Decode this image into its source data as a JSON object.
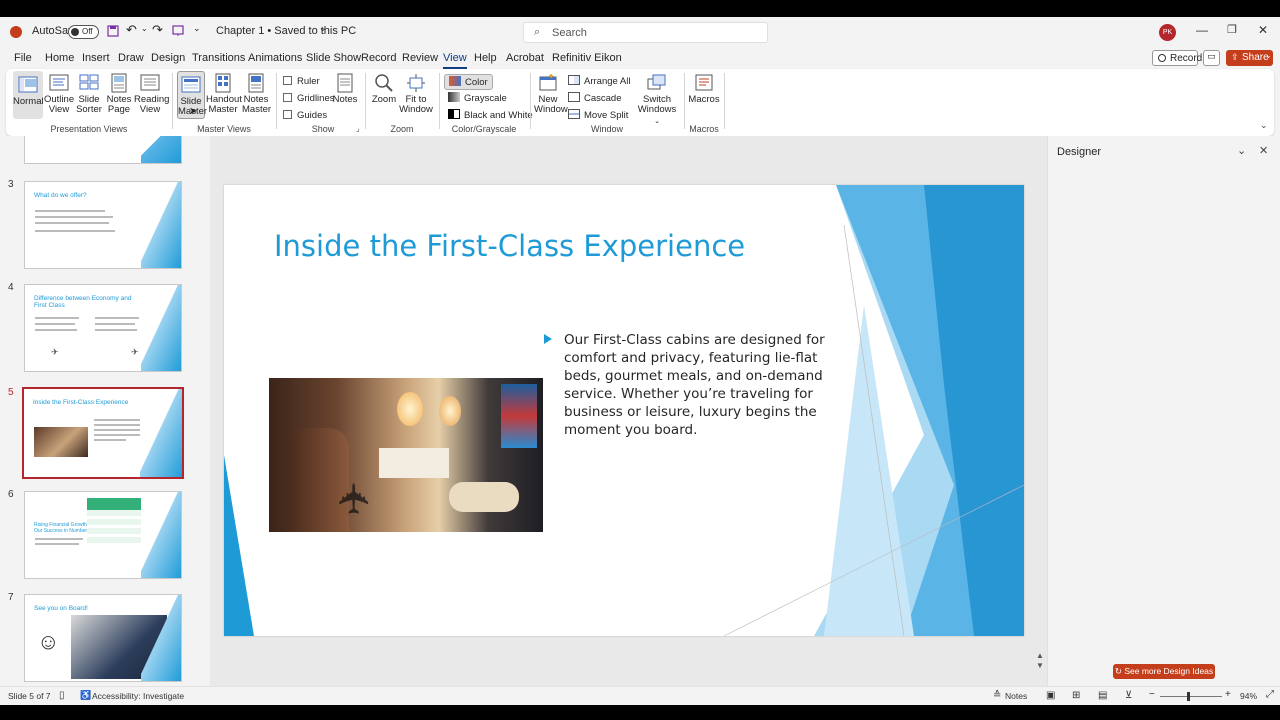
{
  "titlebar": {
    "autosave_label": "AutoSave",
    "autosave_state": "Off",
    "doc_title": "Chapter 1 • Saved to this PC",
    "search_placeholder": "Search",
    "user_initials": "PK"
  },
  "menu": {
    "tabs": [
      "File",
      "Home",
      "Insert",
      "Draw",
      "Design",
      "Transitions",
      "Animations",
      "Slide Show",
      "Record",
      "Review",
      "View",
      "Help",
      "Acrobat",
      "Refinitiv Eikon"
    ],
    "active_tab": "View",
    "record_label": "Record",
    "share_label": "Share"
  },
  "ribbon": {
    "presentation_views": {
      "label": "Presentation Views",
      "normal": "Normal",
      "outline_view": [
        "Outline",
        "View"
      ],
      "slide_sorter": [
        "Slide",
        "Sorter"
      ],
      "notes_page": [
        "Notes",
        "Page"
      ],
      "reading_view": [
        "Reading",
        "View"
      ]
    },
    "master_views": {
      "label": "Master Views",
      "slide_master": [
        "Slide",
        "Master"
      ],
      "handout_master": [
        "Handout",
        "Master"
      ],
      "notes_master": [
        "Notes",
        "Master"
      ]
    },
    "show": {
      "label": "Show",
      "ruler": "Ruler",
      "gridlines": "Gridlines",
      "guides": "Guides",
      "notes": "Notes"
    },
    "zoom": {
      "label": "Zoom",
      "zoom": "Zoom",
      "fit_to_window": [
        "Fit to",
        "Window"
      ]
    },
    "color": {
      "label": "Color/Grayscale",
      "color": "Color",
      "grayscale": "Grayscale",
      "black_white": "Black and White"
    },
    "window": {
      "label": "Window",
      "new_window": [
        "New",
        "Window"
      ],
      "arrange_all": "Arrange All",
      "cascade": "Cascade",
      "move_split": "Move Split",
      "switch_windows": [
        "Switch",
        "Windows"
      ]
    },
    "macros": {
      "label": "Macros",
      "macros": "Macros"
    }
  },
  "thumbnails": [
    {
      "num": "3",
      "title": "What do we offer?"
    },
    {
      "num": "4",
      "title": "Difference between Economy and First Class"
    },
    {
      "num": "5",
      "title": "Inside the First-Class Experience"
    },
    {
      "num": "6",
      "title": "Rising Financial Growth: Our Success in Numbers"
    },
    {
      "num": "7",
      "title": "See you on Board!"
    }
  ],
  "slide": {
    "title": "Inside the First-Class Experience",
    "bullet": "Our First-Class cabins are designed for comfort and privacy, featuring lie-flat beds, gourmet meals, and on-demand service. Whether you’re traveling for business or leisure, luxury begins the moment you board."
  },
  "designer": {
    "title": "Designer",
    "more_ideas": "See more Design Ideas"
  },
  "status": {
    "slide_count": "Slide 5 of 7",
    "accessibility": "Accessibility: Investigate",
    "notes": "Notes",
    "zoom": "94%"
  },
  "colors": {
    "accent_red": "#c43e1c",
    "title_blue": "#1e9bd7",
    "tab_active": "#0f3e85"
  }
}
